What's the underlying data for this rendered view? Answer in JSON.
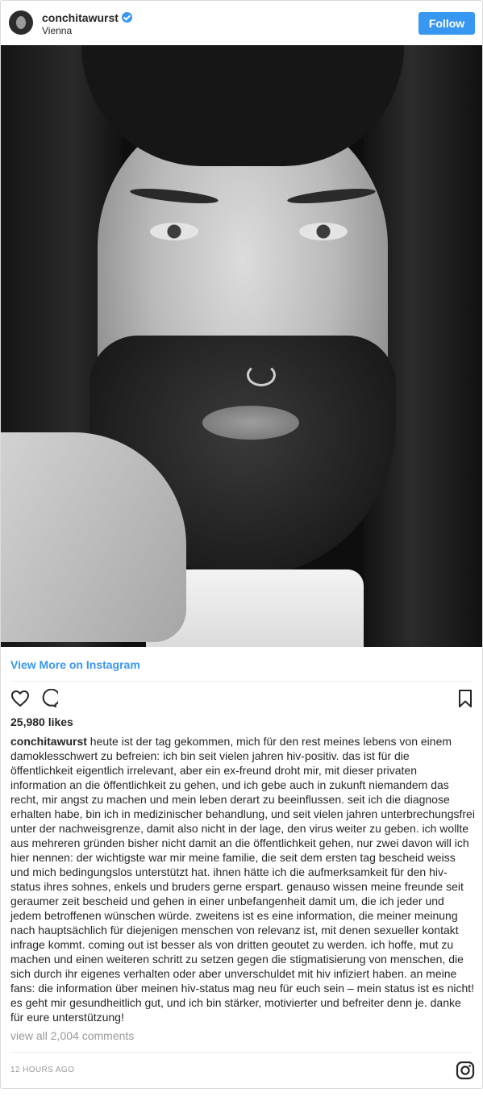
{
  "post": {
    "username": "conchitawurst",
    "location": "Vienna",
    "follow_label": "Follow",
    "view_more_label": "View More on Instagram",
    "likes": "25,980 likes",
    "caption_username": "conchitawurst",
    "caption_text": "heute ist der tag gekommen, mich für den rest meines lebens von einem damoklesschwert zu befreien: ich bin seit vielen jahren hiv-positiv. das ist für die öffentlichkeit eigentlich irrelevant, aber ein ex-freund droht mir, mit dieser privaten information an die öffentlichkeit zu gehen, und ich gebe auch in zukunft niemandem das recht, mir angst zu machen und mein leben derart zu beeinflussen. seit ich die diagnose erhalten habe, bin ich in medizinischer behandlung, und seit vielen jahren unterbrechungsfrei unter der nachweisgrenze, damit also nicht in der lage, den virus weiter zu geben. ich wollte aus mehreren gründen bisher nicht damit an die öffentlichkeit gehen, nur zwei davon will ich hier nennen: der wichtigste war mir meine familie, die seit dem ersten tag bescheid weiss und mich bedingungslos unterstützt hat. ihnen hätte ich die aufmerksamkeit für den hiv-status ihres sohnes, enkels und bruders gerne erspart. genauso wissen meine freunde seit geraumer zeit bescheid und gehen in einer unbefangenheit damit um, die ich jeder und jedem betroffenen wünschen würde. zweitens ist es eine information, die meiner meinung nach hauptsächlich für diejenigen menschen von relevanz ist, mit denen sexueller kontakt infrage kommt. coming out ist besser als von dritten geoutet zu werden. ich hoffe, mut zu machen und einen weiteren schritt zu setzen gegen die stigmatisierung von menschen, die sich durch ihr eigenes verhalten oder aber unverschuldet mit hiv infiziert haben. an meine fans: die information über meinen hiv-status mag neu für euch sein – mein status ist es nicht! es geht mir gesundheitlich gut, und ich bin stärker, motivierter und befreiter denn je. danke für eure unterstützung!",
    "comments_label": "view all 2,004 comments",
    "timestamp": "12 HOURS AGO"
  },
  "icons": {
    "avatar": "profile-photo",
    "verified": "verified-badge-icon",
    "like": "heart-outline-icon",
    "comment": "comment-bubble-icon",
    "save": "bookmark-outline-icon",
    "brand": "instagram-logo-icon"
  },
  "colors": {
    "accent": "#3897f0",
    "text": "#262626",
    "muted": "#999999",
    "border": "#dbdbdb"
  }
}
